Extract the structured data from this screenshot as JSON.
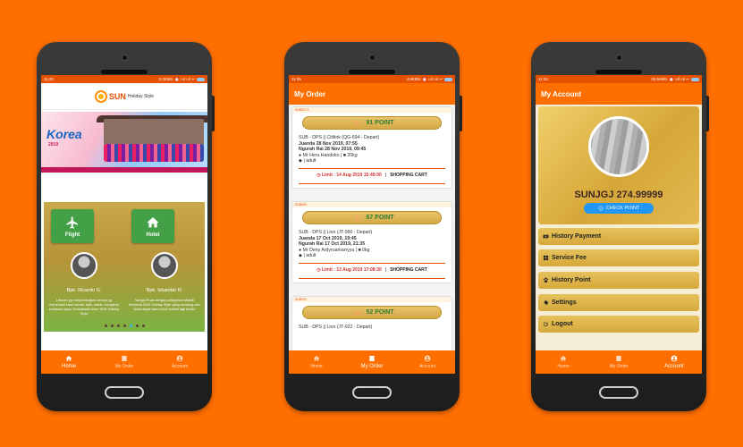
{
  "screen_home": {
    "status": {
      "time": "11:20",
      "speed": "0.0KB/s",
      "signal": "⏰ ıııl ıııl ↩"
    },
    "logo": {
      "brand": "SUN",
      "suffix": "Holiday Style"
    },
    "banner": {
      "title": "Korea",
      "subtitle": "2019"
    },
    "tiles": [
      {
        "label": "Flight",
        "icon": "airplane-icon"
      },
      {
        "label": "Hotel",
        "icon": "home-icon"
      }
    ],
    "testimonials": [
      {
        "name": "Bpk. Ricardo G.",
        "text": "Liburan yg menyenangkan semua yg menemani kami ramah, baik, sabar, mengikuti kemauan saya, terimakasih team SUN Holiday Style"
      },
      {
        "name": "Bpk. Iskandar R.",
        "text": "Sangat Puas dengan pelayanan Mutlak bersama SUN Holiday Style yang memang dan tidak dapat kami sebut terbaik lagi teman"
      }
    ],
    "nav": [
      {
        "label": "Home",
        "icon": "home-icon"
      },
      {
        "label": "My Order",
        "icon": "receipt-icon"
      },
      {
        "label": "Account",
        "icon": "account-icon"
      }
    ]
  },
  "screen_orders": {
    "status": {
      "time": "11:35",
      "speed": "4.8KB/s",
      "signal": "⏰ ıııl ıııl ↩"
    },
    "title": "My Order",
    "orders": [
      {
        "code": "SUBAT17",
        "points": "91 POINT",
        "route": "SUB - DPS || Citilink (QG-694 - Depart)",
        "depart": "Juanda 28 Nov 2019, 07:55",
        "arrive": "Ngurah Rai 28 Nov 2019, 09:45",
        "pax": "Mr Heru Handoko | ■ 20kg",
        "type": "| adult",
        "limit": "Limit : 14 Aug 2019 15:49:00",
        "cart": "SHOPPING CART"
      },
      {
        "code": "SUB990",
        "points": "67 POINT",
        "route": "SUB - DPS || Lion (JT-990 - Depart)",
        "depart": "Juanda 17 Oct 2019, 19:45",
        "arrive": "Ngurah Rai 17 Oct 2019, 21:35",
        "pax": "Mr Deny Ardyruamarryya | ■ 0kg",
        "type": "| adult",
        "limit": "Limit : 13 Aug 2019 17:08:30",
        "cart": "SHOPPING CART"
      },
      {
        "code": "SUB922",
        "points": "52 POINT",
        "route": "SUB - DPS || Lion (JT-922 - Depart)"
      }
    ],
    "nav": [
      {
        "label": "Home",
        "icon": "home-icon"
      },
      {
        "label": "My Order",
        "icon": "receipt-icon"
      },
      {
        "label": "Account",
        "icon": "account-icon"
      }
    ]
  },
  "screen_account": {
    "status": {
      "time": "11:34",
      "speed": "25.5KB/s",
      "signal": "⏰ ıııl ıııl ↩"
    },
    "title": "My Account",
    "profile": {
      "name": "SUNJGJ 274.99999",
      "check_label": "CHECK POINT"
    },
    "menu": [
      {
        "label": "History Payment",
        "icon": "money-icon"
      },
      {
        "label": "Service Fee",
        "icon": "grid-icon"
      },
      {
        "label": "History Point",
        "icon": "paw-icon"
      },
      {
        "label": "Settings",
        "icon": "gear-icon"
      },
      {
        "label": "Logout",
        "icon": "logout-icon"
      }
    ],
    "nav": [
      {
        "label": "Home",
        "icon": "home-icon"
      },
      {
        "label": "My Order",
        "icon": "receipt-icon"
      },
      {
        "label": "Account",
        "icon": "account-icon"
      }
    ]
  },
  "colors": {
    "brand_orange": "#FF6F00",
    "gold": "#D6A83A",
    "green": "#43A047",
    "blue": "#2196F3"
  }
}
